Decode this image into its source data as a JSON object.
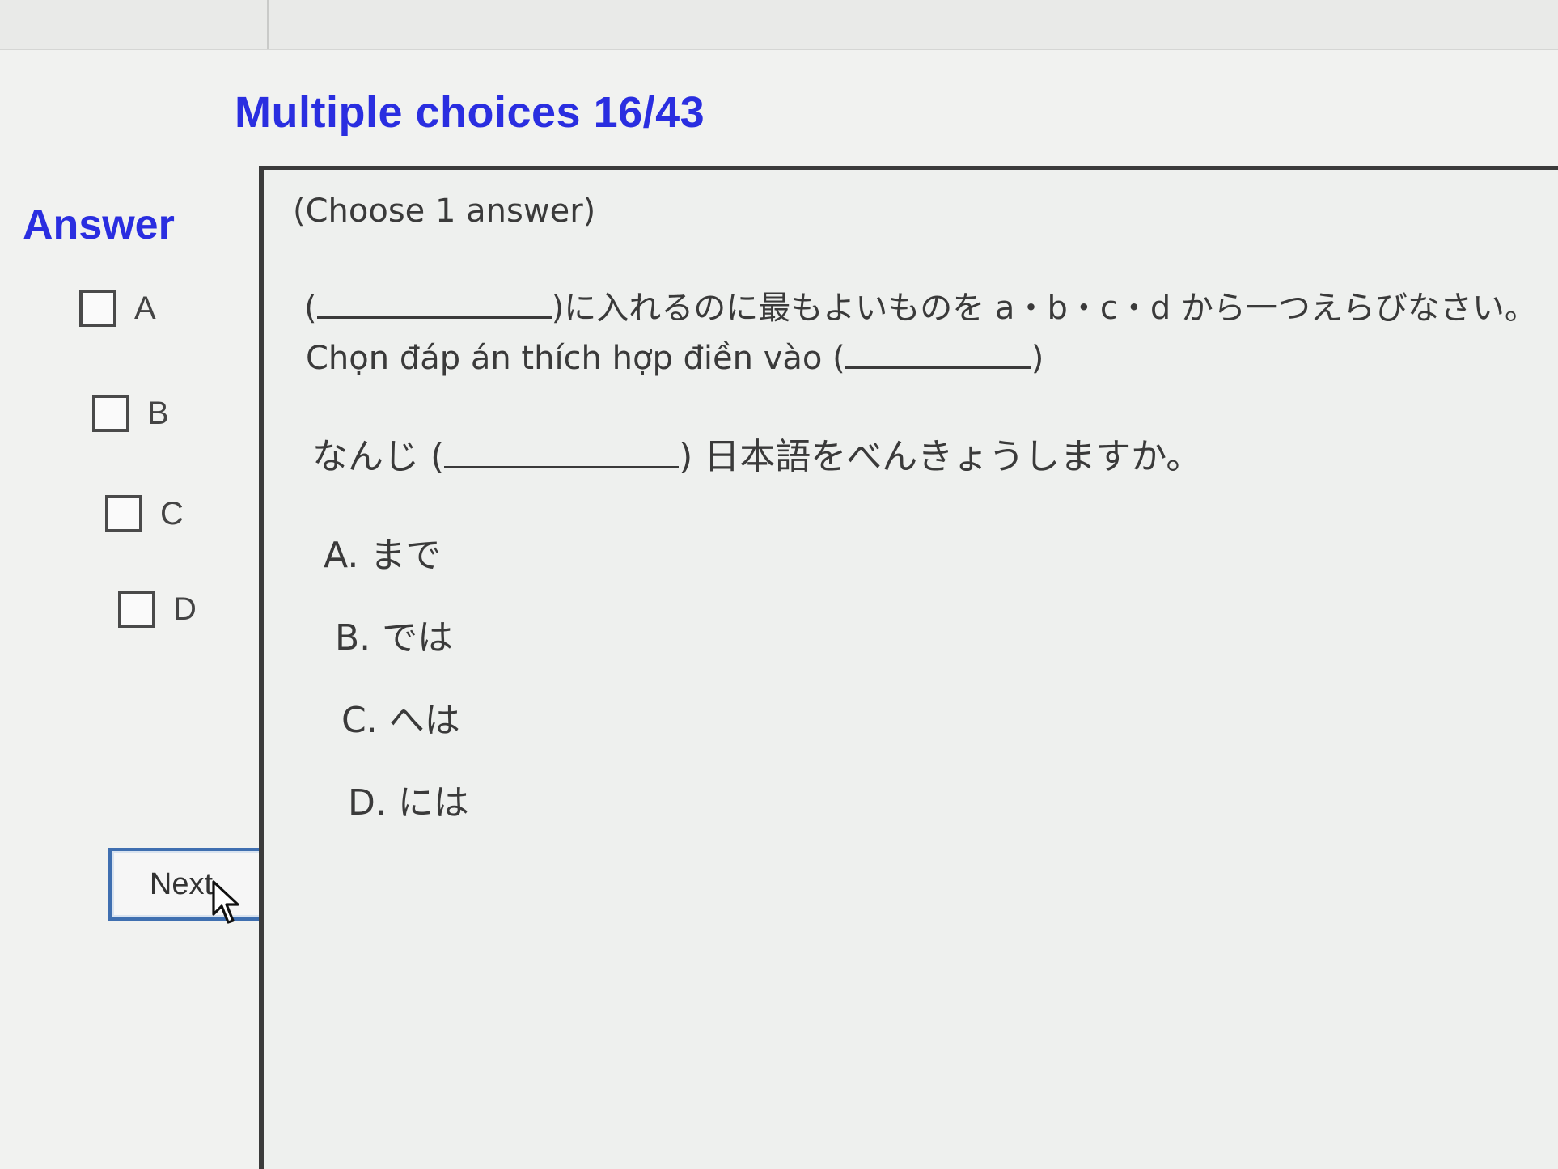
{
  "header": {
    "title": "Multiple choices 16/43"
  },
  "sidebar": {
    "heading": "Answer",
    "options": [
      {
        "label": "A"
      },
      {
        "label": "B"
      },
      {
        "label": "C"
      },
      {
        "label": "D"
      }
    ],
    "next_label": "Next"
  },
  "question": {
    "instruction": "(Choose 1 answer)",
    "jp_instruction_open": "(",
    "jp_instruction_close": ")に入れるのに最もよいものを a・b・c・d から一つえらびなさい。",
    "vn_instruction_prefix": "Chọn đáp án thích hợp điền vào (",
    "vn_instruction_suffix": ")",
    "sentence_prefix": "なんじ (",
    "sentence_suffix": ") 日本語をべんきょうしますか。",
    "choices": [
      {
        "letter": "A.",
        "text": "まで"
      },
      {
        "letter": "B.",
        "text": "では"
      },
      {
        "letter": "C.",
        "text": "へは"
      },
      {
        "letter": "D.",
        "text": "には"
      }
    ]
  },
  "colors": {
    "accent": "#2a2ee0",
    "button_border": "#3f6fb0",
    "background": "#f1f2f0"
  }
}
